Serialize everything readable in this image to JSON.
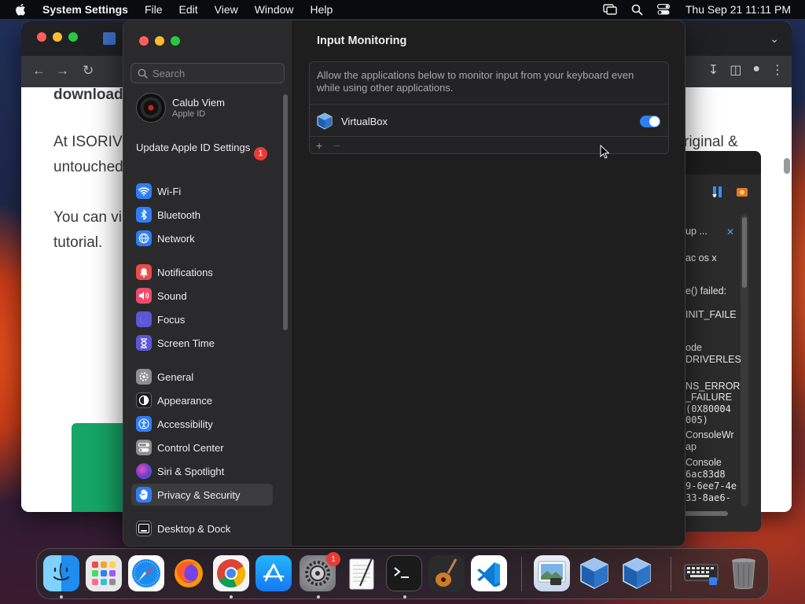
{
  "menubar": {
    "app": "System Settings",
    "items": [
      "File",
      "Edit",
      "View",
      "Window",
      "Help"
    ],
    "clock": "Thu Sep 21  11:11 PM"
  },
  "browser": {
    "text_lines": [
      "download",
      "At ISORIV",
      "untouched",
      "You can vi",
      "tutorial.",
      "riginal &"
    ]
  },
  "console": {
    "lines": [
      "up ...",
      "ac os x",
      "e() failed:",
      "INIT_FAILE",
      "ode",
      "DRIVERLES",
      "NS_ERROR",
      "_FAILURE",
      "(0X80004",
      "005)",
      "ConsoleWr",
      "ap",
      "Console",
      "6ac83d8",
      "9-6ee7-4e",
      "33-8ae6-"
    ]
  },
  "settings": {
    "search_placeholder": "Search",
    "account": {
      "name": "Calub Viem",
      "sub": "Apple ID"
    },
    "update": {
      "label": "Update Apple ID Settings",
      "badge": "1"
    },
    "sidebar": [
      {
        "label": "Wi-Fi"
      },
      {
        "label": "Bluetooth"
      },
      {
        "label": "Network"
      },
      {
        "label": "Notifications"
      },
      {
        "label": "Sound"
      },
      {
        "label": "Focus"
      },
      {
        "label": "Screen Time"
      },
      {
        "label": "General"
      },
      {
        "label": "Appearance"
      },
      {
        "label": "Accessibility"
      },
      {
        "label": "Control Center"
      },
      {
        "label": "Siri & Spotlight"
      },
      {
        "label": "Privacy & Security"
      },
      {
        "label": "Desktop & Dock"
      }
    ],
    "main": {
      "title": "Input Monitoring",
      "description": "Allow the applications below to monitor input from your keyboard even while using other applications.",
      "apps": [
        {
          "name": "VirtualBox",
          "enabled": true
        }
      ],
      "add": "+",
      "remove": "−"
    }
  },
  "dock": {
    "apps": [
      "Finder",
      "Launchpad",
      "Safari",
      "Firefox",
      "Chrome",
      "App Store",
      "System Settings",
      "TextEdit",
      "Terminal",
      "GarageBand",
      "VS Code",
      "Preview",
      "VirtualBox",
      "VirtualBox",
      "Keyboard Viewer",
      "Trash"
    ],
    "settings_badge": "1"
  }
}
